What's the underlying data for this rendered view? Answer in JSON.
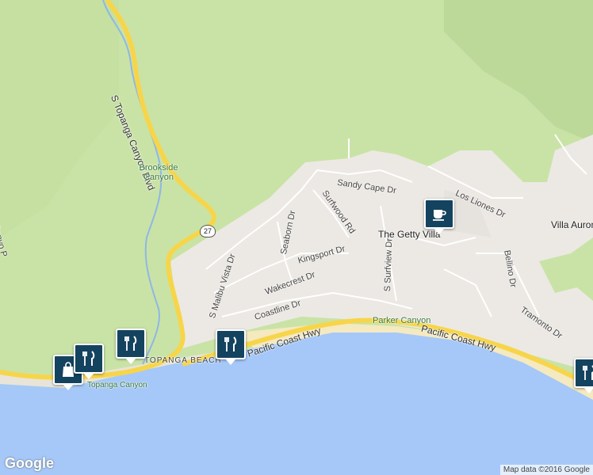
{
  "map": {
    "colors": {
      "park": "#c9e3a6",
      "urban": "#ece9e4",
      "water": "#a5c8f8",
      "highway": "#f7d54a",
      "sand": "#f5e9c0"
    },
    "labels": {
      "topanga_blvd": "S Topanga Canyon Blvd",
      "brookside": "Brookside Canyon",
      "route_shield": "27",
      "sandy_cape": "Sandy Cape Dr",
      "los_liones": "Los Liones Dr",
      "surfwood": "Surfwood Rd",
      "seaborn": "Seaborn Dr",
      "getty_villa": "The Getty Villa",
      "villa_aurora": "Villa Auron",
      "malibu_vista": "S Malibu Vista Dr",
      "kingsport": "Kingsport Dr",
      "wakecrest": "Wakecrest Dr",
      "s_surfview": "S Surfview Dr",
      "bellino": "Bellino Dr",
      "coastline": "Coastline Dr",
      "tramonto": "Tramonto Dr",
      "parker_canyon": "Parker Canyon",
      "pch_1": "Pacific Coast Hwy",
      "pch_2": "Pacific Coast Hwy",
      "topanga_beach": "TOPANGA BEACH",
      "topanga_canyon": "Topanga Canyon",
      "left_edge": "Canyo P"
    },
    "markers": [
      {
        "type": "shopping-bag",
        "label": "Shopping"
      },
      {
        "type": "restaurant",
        "label": "Restaurant"
      },
      {
        "type": "restaurant",
        "label": "Restaurant"
      },
      {
        "type": "restaurant",
        "label": "Restaurant"
      },
      {
        "type": "cafe",
        "label": "Cafe"
      },
      {
        "type": "restaurant",
        "label": "Restaurant"
      }
    ],
    "logo": "Google",
    "attribution": "Map data ©2016 Google"
  }
}
